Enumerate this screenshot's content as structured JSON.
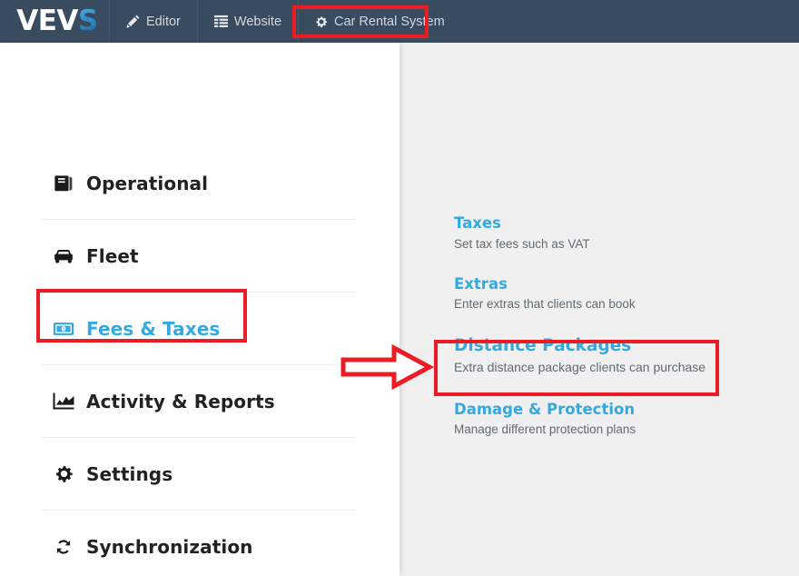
{
  "header": {
    "logo": {
      "primary": "VEV",
      "accent": "S",
      "accent_color": "#2f8fc9"
    },
    "background_color": "#384b5f",
    "nav_items": [
      {
        "label": "Editor",
        "icon": "pencil-icon"
      },
      {
        "label": "Website",
        "icon": "list-icon"
      },
      {
        "label": "Car Rental System",
        "icon": "gear-icon"
      }
    ]
  },
  "sidebar": {
    "active_color": "#34a9e0",
    "items": [
      {
        "label": "Operational",
        "icon": "book-icon",
        "active": false
      },
      {
        "label": "Fleet",
        "icon": "car-icon",
        "active": false
      },
      {
        "label": "Fees & Taxes",
        "icon": "money-icon",
        "active": true
      },
      {
        "label": "Activity & Reports",
        "icon": "chart-icon",
        "active": false
      },
      {
        "label": "Settings",
        "icon": "gear-icon",
        "active": false
      },
      {
        "label": "Synchronization",
        "icon": "refresh-icon",
        "active": false
      }
    ]
  },
  "submenu": {
    "items": [
      {
        "title": "Taxes",
        "desc": "Set tax fees such as VAT"
      },
      {
        "title": "Extras",
        "desc": "Enter extras that clients can book"
      },
      {
        "title": "Distance Packages",
        "desc": "Extra distance package clients can purchase"
      },
      {
        "title": "Damage & Protection",
        "desc": "Manage different protection plans"
      }
    ]
  },
  "annotations": {
    "color": "#ed1c24",
    "boxes": [
      "car-rental-system-tab",
      "fees-and-taxes-menu-item",
      "distance-packages-link"
    ],
    "arrow": "points-right-to-distance-packages"
  }
}
